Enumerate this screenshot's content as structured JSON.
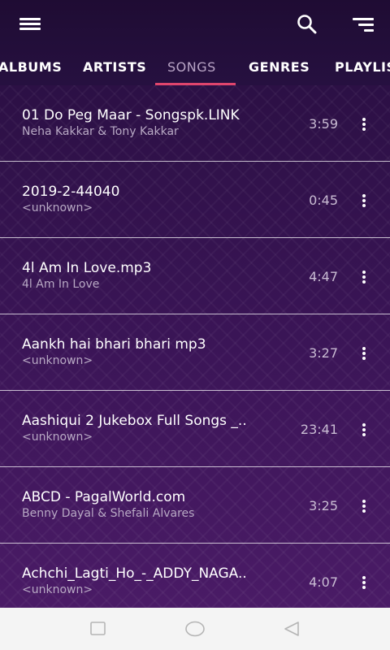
{
  "tabs": [
    {
      "label": "ALBUMS",
      "active": false
    },
    {
      "label": "ARTISTS",
      "active": false
    },
    {
      "label": "SONGS",
      "active": true
    },
    {
      "label": "GENRES",
      "active": false
    },
    {
      "label": "PLAYLISTS",
      "active": false
    }
  ],
  "songs": [
    {
      "title": "01 Do Peg Maar - Songspk.LINK",
      "artist": "Neha Kakkar & Tony Kakkar",
      "duration": "3:59"
    },
    {
      "title": "2019-2-44040",
      "artist": "<unknown>",
      "duration": "0:45"
    },
    {
      "title": "4l Am In Love.mp3",
      "artist": "4l Am In Love",
      "duration": "4:47"
    },
    {
      "title": "Aankh hai bhari bhari mp3",
      "artist": "<unknown>",
      "duration": "3:27"
    },
    {
      "title": "Aashiqui 2 Jukebox Full Songs _..",
      "artist": "<unknown>",
      "duration": "23:41"
    },
    {
      "title": "ABCD - PagalWorld.com",
      "artist": "Benny Dayal & Shefali Alvares",
      "duration": "3:25"
    },
    {
      "title": "Achchi_Lagti_Ho_-_ADDY_NAGA..",
      "artist": "<unknown>",
      "duration": "4:07"
    }
  ],
  "icons": {
    "menu": "hamburger-menu-icon",
    "search": "search-icon",
    "sort": "sort-icon",
    "more": "more-vertical-icon",
    "recents": "square-icon",
    "home": "circle-icon",
    "back": "triangle-back-icon"
  },
  "colors": {
    "topbar": "#1f0c33",
    "accent": "#e0456d",
    "active_tab_text": "#b9a5c6",
    "list_background": "#3a1556",
    "navbar": "#f4f4f4"
  }
}
